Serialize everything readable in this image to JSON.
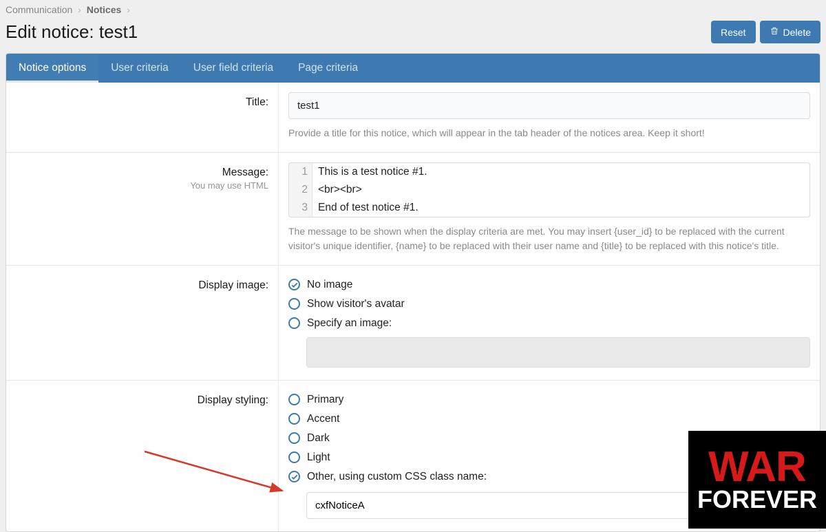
{
  "breadcrumb": {
    "parent": "Communication",
    "current": "Notices"
  },
  "page_title": "Edit notice: test1",
  "header_buttons": {
    "reset": "Reset",
    "delete": "Delete"
  },
  "tabs": {
    "notice_options": "Notice options",
    "user_criteria": "User criteria",
    "user_field_criteria": "User field criteria",
    "page_criteria": "Page criteria"
  },
  "fields": {
    "title": {
      "label": "Title:",
      "value": "test1",
      "help": "Provide a title for this notice, which will appear in the tab header of the notices area. Keep it short!"
    },
    "message": {
      "label": "Message:",
      "sublabel": "You may use HTML",
      "lines": {
        "n1": "1",
        "l1": "This is a test notice #1.",
        "n2": "2",
        "l2": "<br><br>",
        "n3": "3",
        "l3": "End of test notice #1."
      },
      "help": "The message to be shown when the display criteria are met. You may insert {user_id} to be replaced with the current visitor's unique identifier, {name} to be replaced with their user name and {title} to be replaced with this notice's title."
    },
    "display_image": {
      "label": "Display image:",
      "options": {
        "none": "No image",
        "avatar": "Show visitor's avatar",
        "specify": "Specify an image:"
      }
    },
    "display_styling": {
      "label": "Display styling:",
      "options": {
        "primary": "Primary",
        "accent": "Accent",
        "dark": "Dark",
        "light": "Light",
        "other": "Other, using custom CSS class name:"
      },
      "css_value": "cxfNoticeA"
    }
  },
  "logo": {
    "line1": "WAR",
    "line2": "FOREVER"
  }
}
